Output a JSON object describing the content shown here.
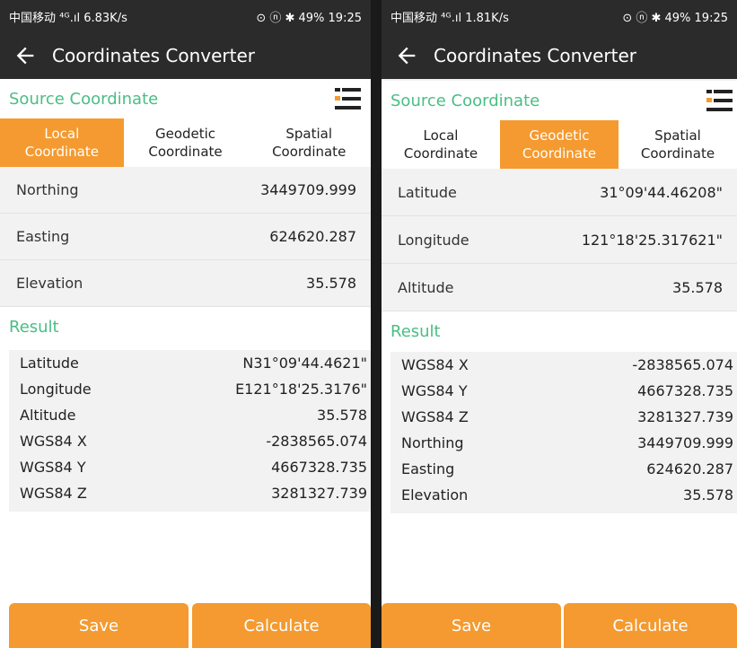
{
  "colors": {
    "accent": "#f49a30",
    "header_green": "#4bbd84",
    "bar_dark": "#2b2b2b"
  },
  "left": {
    "status": {
      "carrier": "中国移动",
      "net": "⁴ᴳ.ıl",
      "speed": "6.83K/s",
      "right": "⊙ ⓝ ✱ 49%",
      "time": "19:25"
    },
    "title": "Coordinates Converter",
    "source_header": "Source Coordinate",
    "tabs": [
      {
        "l1": "Local",
        "l2": "Coordinate",
        "active": true
      },
      {
        "l1": "Geodetic",
        "l2": "Coordinate",
        "active": false
      },
      {
        "l1": "Spatial",
        "l2": "Coordinate",
        "active": false
      }
    ],
    "fields": [
      {
        "label": "Northing",
        "value": "3449709.999"
      },
      {
        "label": "Easting",
        "value": "624620.287"
      },
      {
        "label": "Elevation",
        "value": "35.578"
      }
    ],
    "result_header": "Result",
    "results": [
      {
        "label": "Latitude",
        "value": "N31°09'44.4621\""
      },
      {
        "label": "Longitude",
        "value": "E121°18'25.3176\""
      },
      {
        "label": "Altitude",
        "value": "35.578"
      },
      {
        "label": "WGS84 X",
        "value": "-2838565.074"
      },
      {
        "label": "WGS84 Y",
        "value": "4667328.735"
      },
      {
        "label": "WGS84 Z",
        "value": "3281327.739"
      }
    ],
    "save_label": "Save",
    "calc_label": "Calculate"
  },
  "right": {
    "status": {
      "carrier": "中国移动",
      "net": "⁴ᴳ.ıl",
      "speed": "1.81K/s",
      "right": "⊙ ⓝ ✱ 49%",
      "time": "19:25"
    },
    "title": "Coordinates Converter",
    "source_header": "Source Coordinate",
    "tabs": [
      {
        "l1": "Local",
        "l2": "Coordinate",
        "active": false
      },
      {
        "l1": "Geodetic",
        "l2": "Coordinate",
        "active": true
      },
      {
        "l1": "Spatial",
        "l2": "Coordinate",
        "active": false
      }
    ],
    "fields": [
      {
        "label": "Latitude",
        "value": "31°09'44.46208\""
      },
      {
        "label": "Longitude",
        "value": "121°18'25.317621\""
      },
      {
        "label": "Altitude",
        "value": "35.578"
      }
    ],
    "result_header": "Result",
    "results": [
      {
        "label": "WGS84 X",
        "value": "-2838565.074"
      },
      {
        "label": "WGS84 Y",
        "value": "4667328.735"
      },
      {
        "label": "WGS84 Z",
        "value": "3281327.739"
      },
      {
        "label": "Northing",
        "value": "3449709.999"
      },
      {
        "label": "Easting",
        "value": "624620.287"
      },
      {
        "label": "Elevation",
        "value": "35.578"
      }
    ],
    "save_label": "Save",
    "calc_label": "Calculate"
  }
}
